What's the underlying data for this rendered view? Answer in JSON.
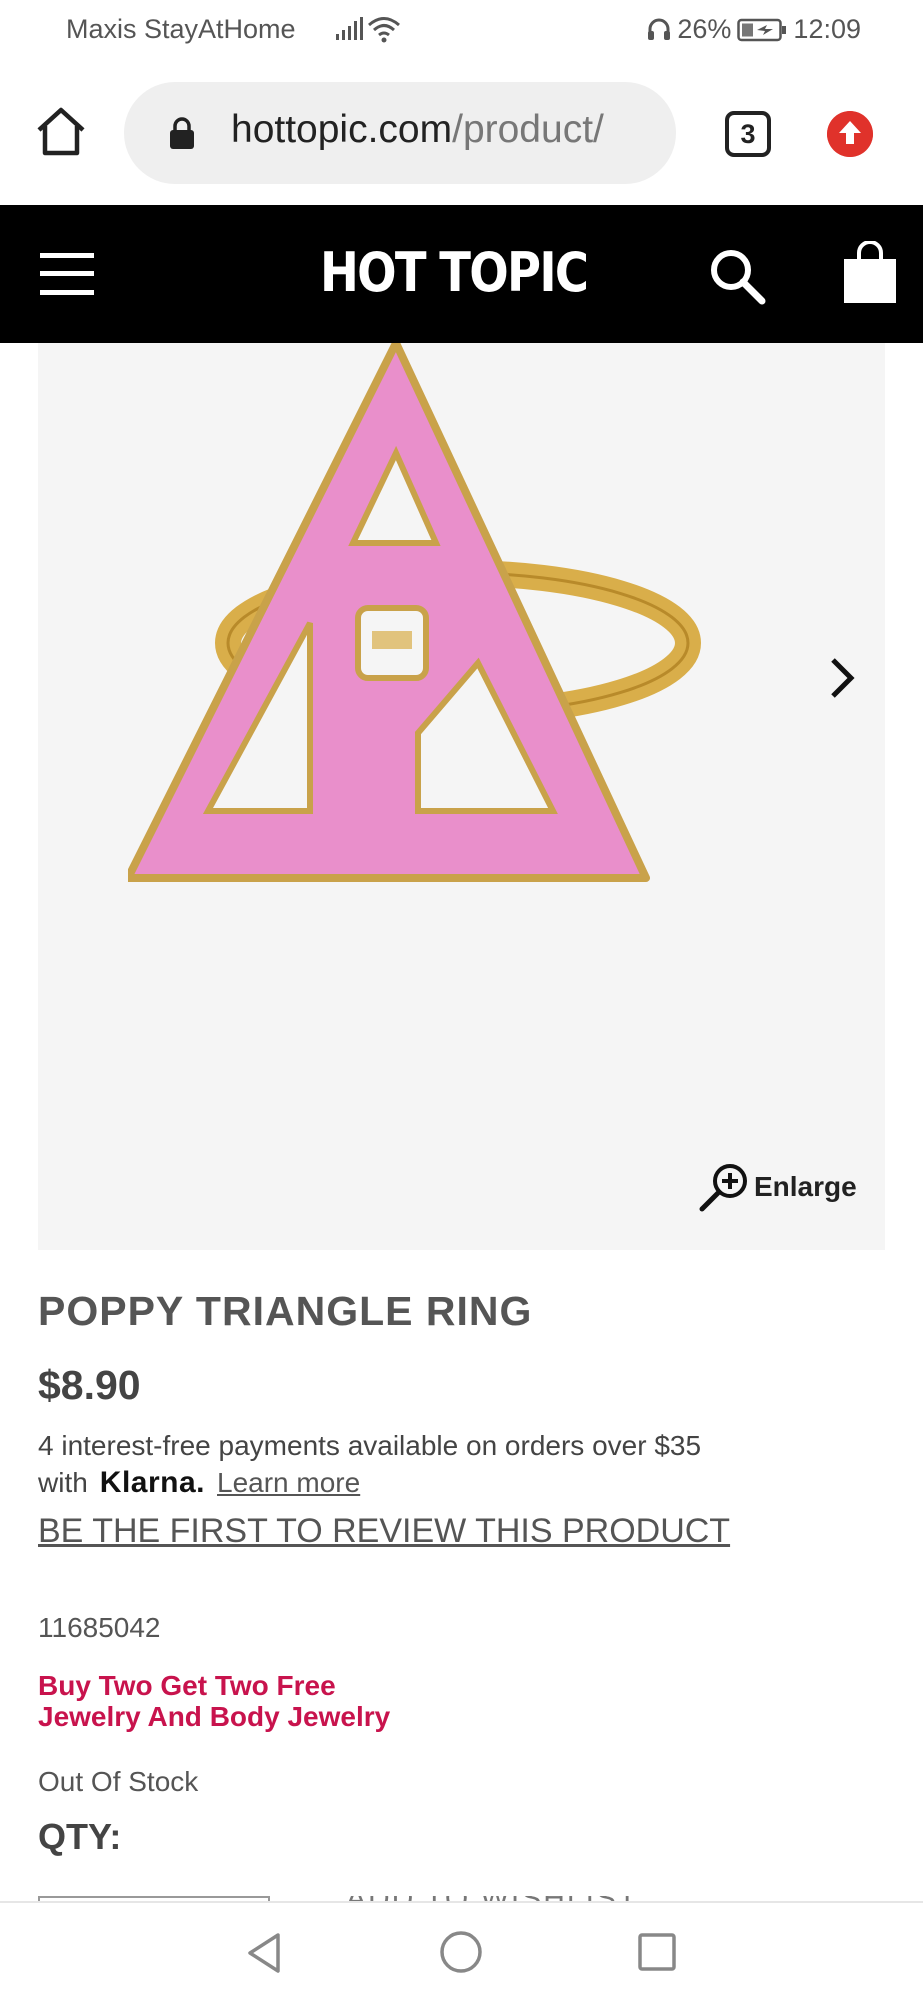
{
  "status_bar": {
    "carrier": "Maxis StayAtHome",
    "battery": "26%",
    "time": "12:09",
    "icons": [
      "signal-icon",
      "wifi-icon",
      "headset-icon",
      "battery-icon"
    ]
  },
  "browser": {
    "url_main": "hottopic.com",
    "url_path": "/product/",
    "tab_count": "3",
    "icons": [
      "home-icon",
      "lock-icon",
      "update-icon"
    ]
  },
  "header": {
    "logo": "HOT TOPIC",
    "icons": [
      "menu-icon",
      "search-icon",
      "shopping-bag-icon"
    ]
  },
  "gallery": {
    "enlarge_label": "Enlarge",
    "icons": [
      "chevron-right-icon",
      "zoom-in-icon"
    ]
  },
  "product": {
    "title": "POPPY TRIANGLE RING",
    "price": "$8.90",
    "klarna_line1": "4 interest-free payments available on orders over $35",
    "klarna_with": "with",
    "klarna_brand": "Klarna.",
    "learn_more": "Learn more",
    "review_link": "BE THE FIRST TO REVIEW THIS PRODUCT",
    "sku": "11685042",
    "promo_line1": "Buy Two Get Two Free",
    "promo_line2": "Jewelry And Body Jewelry",
    "stock_status": "Out Of Stock",
    "qty_label": "QTY:",
    "wishlist_label": "ADD TO WISHLIST"
  },
  "colors": {
    "header_bg": "#000000",
    "promo": "#c8134d",
    "ring_enamel": "#e98fcb",
    "ring_gold": "#d9ae4a",
    "update_badge": "#e0322b"
  }
}
